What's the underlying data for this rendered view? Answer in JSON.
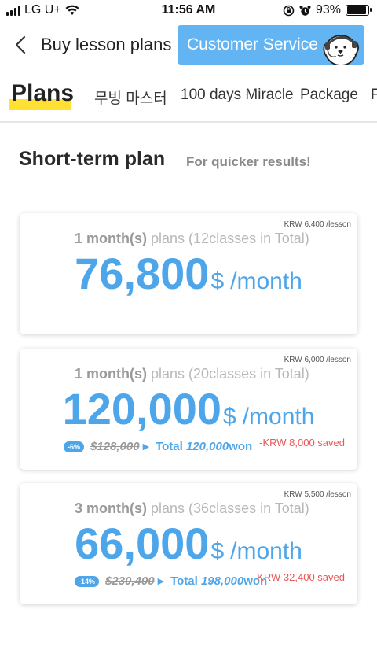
{
  "status_bar": {
    "carrier": "LG U+",
    "time": "11:56 AM",
    "battery": "93%",
    "battery_level": 0.93
  },
  "header": {
    "title": "Buy lesson plans",
    "cs_button_label": "Customer Service"
  },
  "tabs": [
    {
      "label": "Plans"
    },
    {
      "label": "무빙 마스터"
    },
    {
      "label": "100 days Miracle"
    },
    {
      "label": "Package"
    },
    {
      "label": "F"
    }
  ],
  "section": {
    "title": "Short-term plan",
    "subtitle": "For quicker results!"
  },
  "plans": [
    {
      "per_lesson": "KRW 6,400 /lesson",
      "months": "1 month(s)",
      "plan_desc": "plans (12classes in Total)",
      "price": "76,800",
      "currency": "$",
      "unit": "/month"
    },
    {
      "per_lesson": "KRW 6,000 /lesson",
      "months": "1 month(s)",
      "plan_desc": "plans (20classes in Total)",
      "price": "120,000",
      "currency": "$",
      "unit": "/month",
      "discount": "-6%",
      "original": "$128,000",
      "total_label": "Total",
      "total_value": "120,000",
      "total_unit": "won",
      "saved": "-KRW 8,000 saved"
    },
    {
      "per_lesson": "KRW 5,500 /lesson",
      "months": "3 month(s)",
      "plan_desc": "plans (36classes in Total)",
      "price": "66,000",
      "currency": "$",
      "unit": "/month",
      "discount": "-14%",
      "original": "$230,400",
      "total_label": "Total",
      "total_value": "198,000",
      "total_unit": "won",
      "saved": "KRW 32,400 saved"
    }
  ],
  "colors": {
    "accent": "#4ea6ea",
    "cs_button": "#62b5f2",
    "highlight": "#ffe033",
    "saved": "#ec5656"
  }
}
